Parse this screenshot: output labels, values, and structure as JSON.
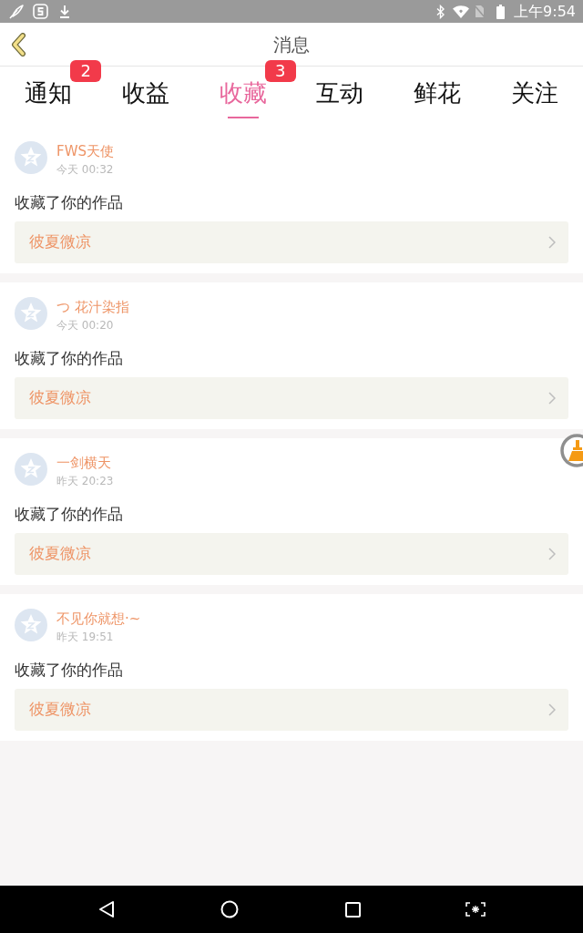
{
  "status_bar": {
    "time": "上午9:54"
  },
  "header": {
    "title": "消息"
  },
  "tabs": [
    {
      "label": "通知",
      "selected": false,
      "badge": "2"
    },
    {
      "label": "收益",
      "selected": false
    },
    {
      "label": "收藏",
      "selected": true,
      "badge": "3"
    },
    {
      "label": "互动",
      "selected": false
    },
    {
      "label": "鲜花",
      "selected": false
    },
    {
      "label": "关注",
      "selected": false
    }
  ],
  "messages": [
    {
      "user": "FWS天使",
      "time": "今天 00:32",
      "text": "收藏了你的作品",
      "work": "彼夏微凉"
    },
    {
      "user": "つ 花汁染指",
      "time": "今天 00:20",
      "text": "收藏了你的作品",
      "work": "彼夏微凉"
    },
    {
      "user": "一剑横天",
      "time": "昨天 20:23",
      "text": "收藏了你的作品",
      "work": "彼夏微凉"
    },
    {
      "user": "不见你就想·~",
      "time": "昨天 19:51",
      "text": "收藏了你的作品",
      "work": "彼夏微凉"
    }
  ]
}
